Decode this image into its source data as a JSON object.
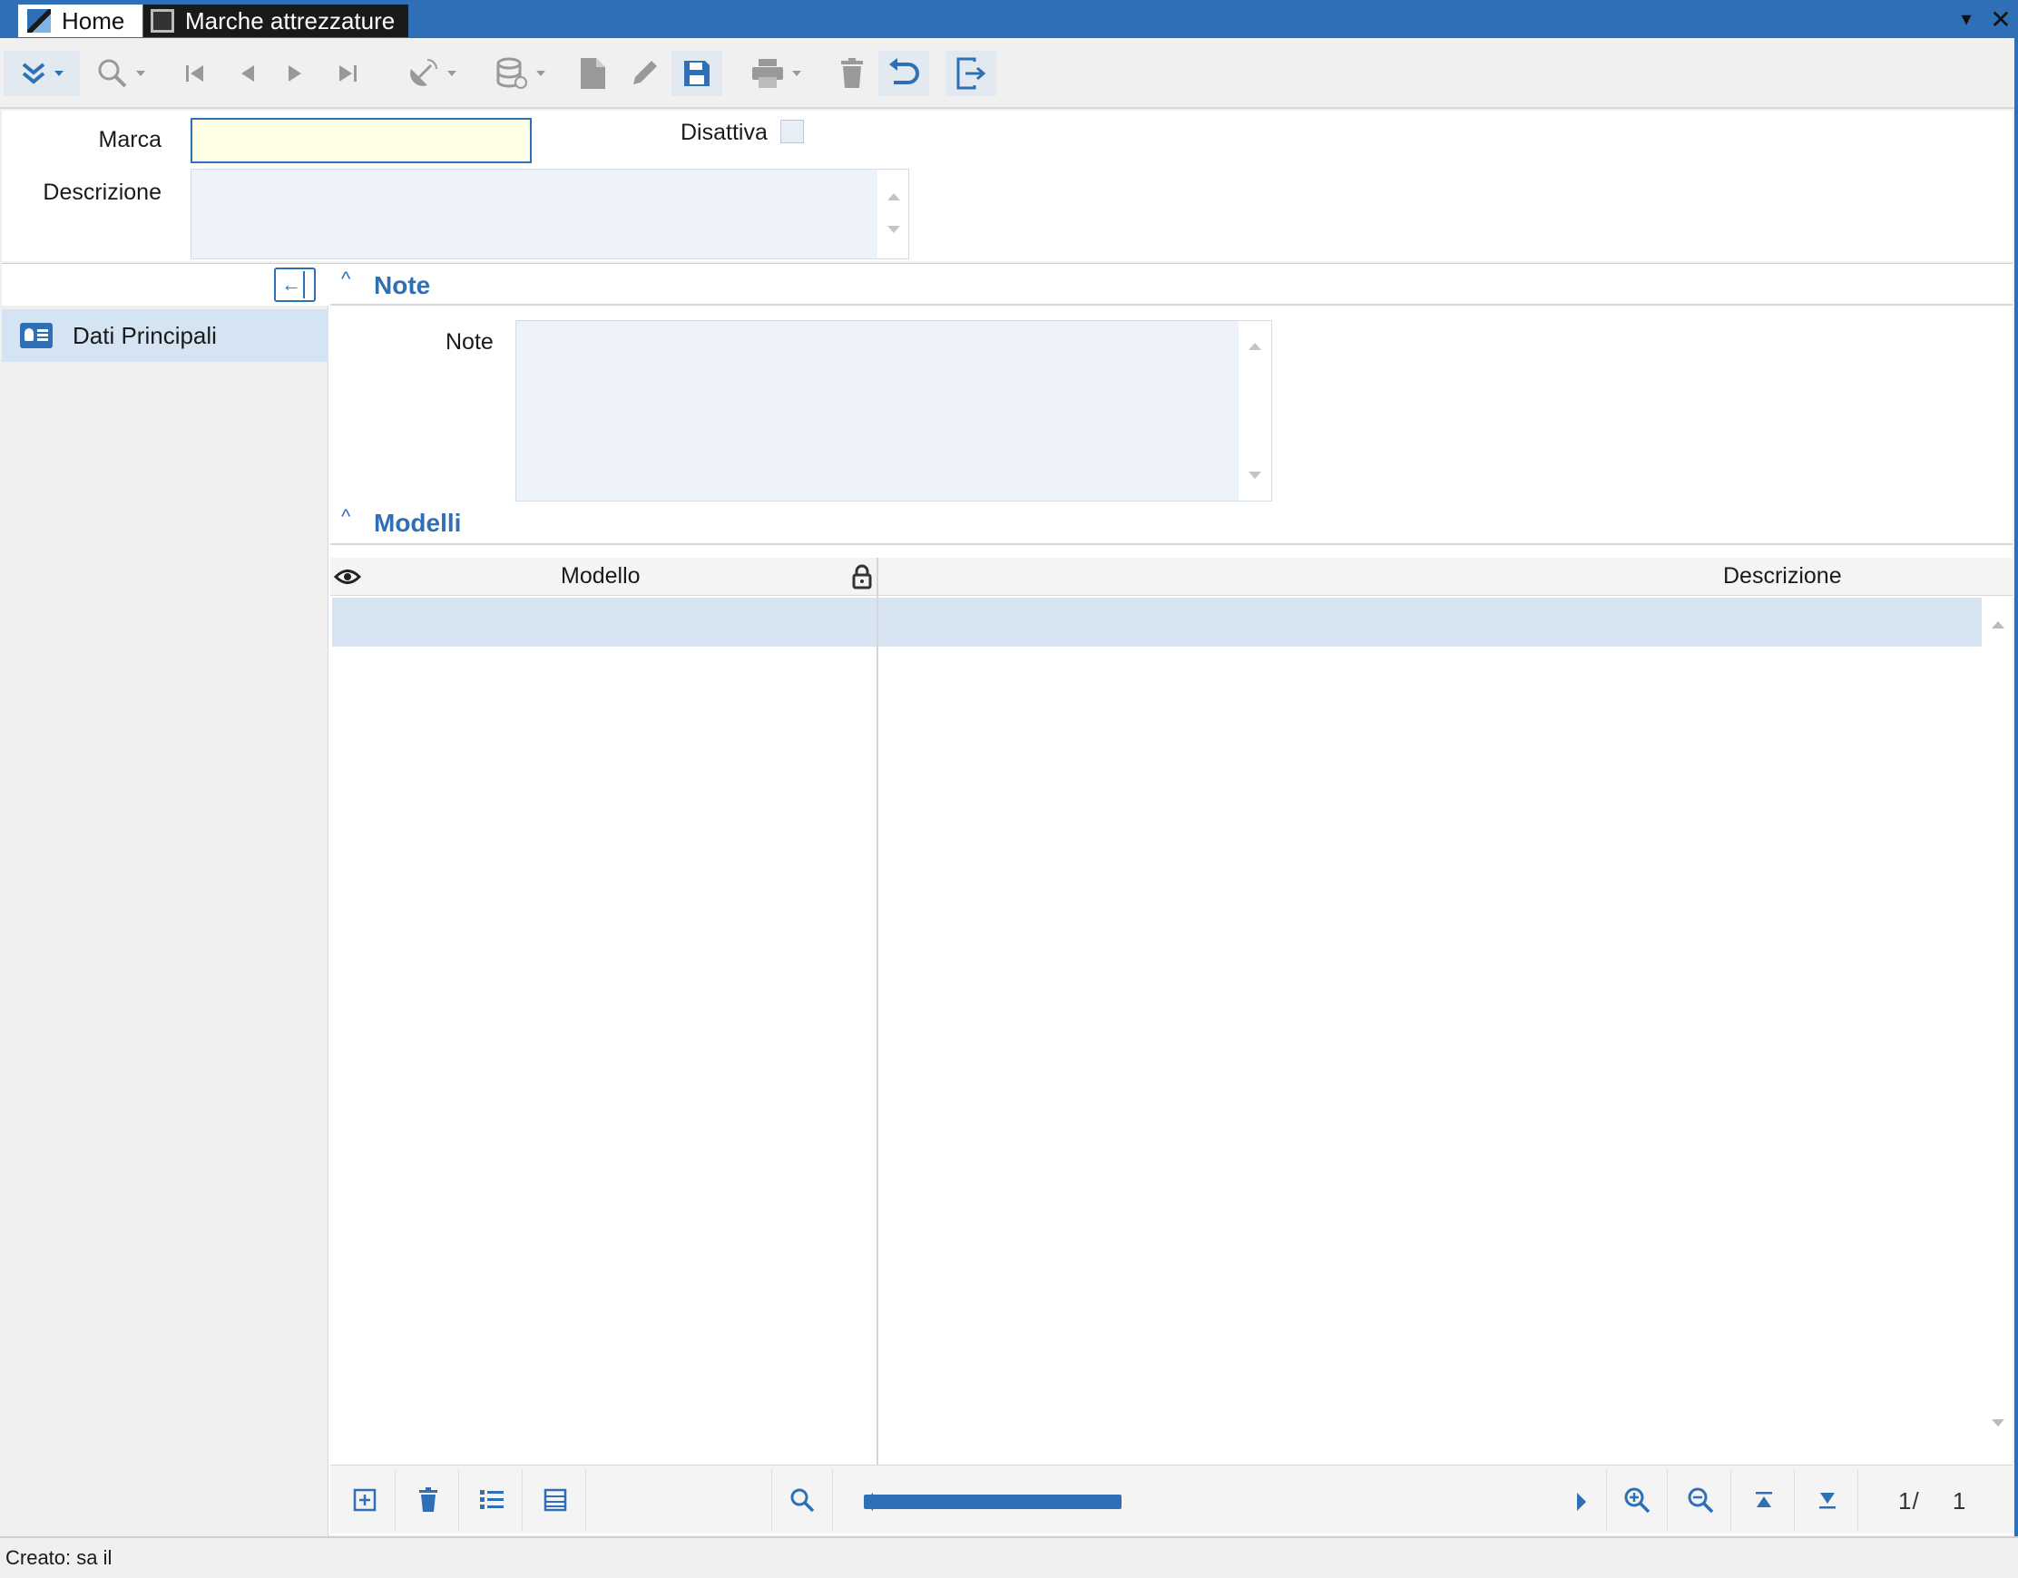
{
  "window": {
    "tabs": [
      {
        "label": "Home"
      },
      {
        "label": "Marche attrezzature"
      }
    ],
    "controls": {
      "dropdown": "▾",
      "close": "✕"
    }
  },
  "toolbar": {
    "buttons": [
      "expand-icon",
      "search-icon",
      "first-record-icon",
      "previous-record-icon",
      "next-record-icon",
      "last-record-icon",
      "satellite-icon",
      "database-icon",
      "new-document-icon",
      "edit-icon",
      "save-icon",
      "print-icon",
      "delete-icon",
      "undo-icon",
      "exit-icon"
    ]
  },
  "header": {
    "marca_label": "Marca",
    "marca_value": "",
    "disattiva_label": "Disattiva",
    "disattiva_checked": false,
    "descrizione_label": "Descrizione",
    "descrizione_value": ""
  },
  "sidebar": {
    "items": [
      {
        "label": "Dati Principali",
        "icon": "id-card-icon",
        "selected": true
      }
    ]
  },
  "sections": {
    "note": {
      "title": "Note",
      "note_label": "Note",
      "note_value": ""
    },
    "modelli": {
      "title": "Modelli",
      "columns": [
        "Modello",
        "Descrizione"
      ],
      "rows": [
        [
          "",
          ""
        ]
      ]
    }
  },
  "grid_footer": {
    "page_current": "1/",
    "page_total": "1"
  },
  "status": {
    "text": "Creato: sa il"
  },
  "colors": {
    "accent": "#2f6fb6",
    "input_highlight": "#ffffe6",
    "selected_row": "#d7e5f2"
  }
}
